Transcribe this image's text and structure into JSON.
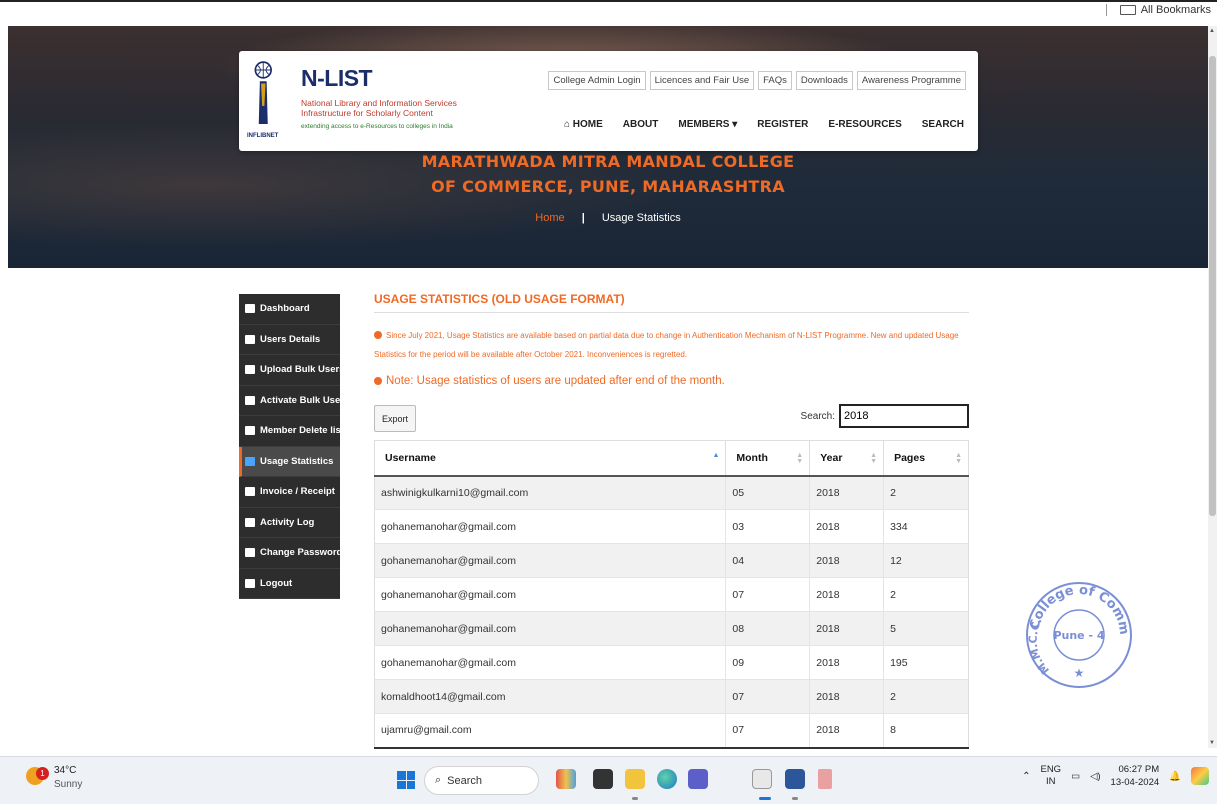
{
  "browser": {
    "bookmarks_label": "All Bookmarks"
  },
  "header": {
    "logo": {
      "name": "N-LIST",
      "subtitle_line1": "National Library and Information Services",
      "subtitle_line2": "Infrastructure for Scholarly Content",
      "tagline": "extending access to e-Resources to colleges in India",
      "org": "INFLIBNET"
    },
    "top_links": [
      "College Admin Login",
      "Licences and Fair Use",
      "FAQs",
      "Downloads",
      "Awareness Programme"
    ],
    "nav": {
      "home": "HOME",
      "about": "ABOUT",
      "members": "MEMBERS ▾",
      "register": "REGISTER",
      "eresources": "E-RESOURCES",
      "search": "SEARCH"
    }
  },
  "hero": {
    "title_line1": "MARATHWADA MITRA MANDAL COLLEGE",
    "title_line2": "OF COMMERCE, PUNE, MAHARASHTRA",
    "breadcrumb_home": "Home",
    "breadcrumb_sep": "|",
    "breadcrumb_current": "Usage Statistics"
  },
  "sidebar": {
    "items": [
      {
        "label": "Dashboard",
        "icon": "dashboard-icon"
      },
      {
        "label": "Users Details",
        "icon": "users-icon"
      },
      {
        "label": "Upload Bulk Users",
        "icon": "upload-users-icon"
      },
      {
        "label": "Activate Bulk Users",
        "icon": "check-square-icon"
      },
      {
        "label": "Member Delete list",
        "icon": "trash-icon"
      },
      {
        "label": "Usage Statistics",
        "icon": "bar-chart-icon"
      },
      {
        "label": "Invoice / Receipt",
        "icon": "print-icon"
      },
      {
        "label": "Activity Log",
        "icon": "list-icon"
      },
      {
        "label": "Change Password",
        "icon": "key-icon"
      },
      {
        "label": "Logout",
        "icon": "logout-icon"
      }
    ],
    "active_index": 5
  },
  "main": {
    "section_title": "USAGE STATISTICS (OLD USAGE FORMAT)",
    "notice_small": "Since July 2021, Usage Statistics are available based on partial data due to change in Authentication Mechanism of N-LIST Programme. New and updated Usage Statistics for the period will be available after October 2021. Inconveniences is regretted.",
    "notice_big": "Note: Usage statistics of users are updated after end of the month.",
    "export_label": "Export",
    "search_label": "Search:",
    "search_value": "2018",
    "columns": [
      "Username",
      "Month",
      "Year",
      "Pages"
    ],
    "rows": [
      [
        "ashwinigkulkarni10@gmail.com",
        "05",
        "2018",
        "2"
      ],
      [
        "gohanemanohar@gmail.com",
        "03",
        "2018",
        "334"
      ],
      [
        "gohanemanohar@gmail.com",
        "04",
        "2018",
        "12"
      ],
      [
        "gohanemanohar@gmail.com",
        "07",
        "2018",
        "2"
      ],
      [
        "gohanemanohar@gmail.com",
        "08",
        "2018",
        "5"
      ],
      [
        "gohanemanohar@gmail.com",
        "09",
        "2018",
        "195"
      ],
      [
        "komaldhoot14@gmail.com",
        "07",
        "2018",
        "2"
      ],
      [
        "ujamru@gmail.com",
        "07",
        "2018",
        "8"
      ]
    ]
  },
  "stamp": {
    "top_text": "College of Commerce",
    "left_text": "M.M.C.C.",
    "center_text": "Pune - 4",
    "star": "★",
    "color": "#7a8fd6"
  },
  "taskbar": {
    "weather_temp": "34°C",
    "weather_cond": "Sunny",
    "weather_badge": "1",
    "search_label": "Search",
    "lang_line1": "ENG",
    "lang_line2": "IN",
    "time": "06:27 PM",
    "date": "13-04-2024"
  },
  "colors": {
    "accent": "#ef6a25",
    "sidebar_bg": "#2d2d2d",
    "brand_blue": "#1b2d6b"
  }
}
